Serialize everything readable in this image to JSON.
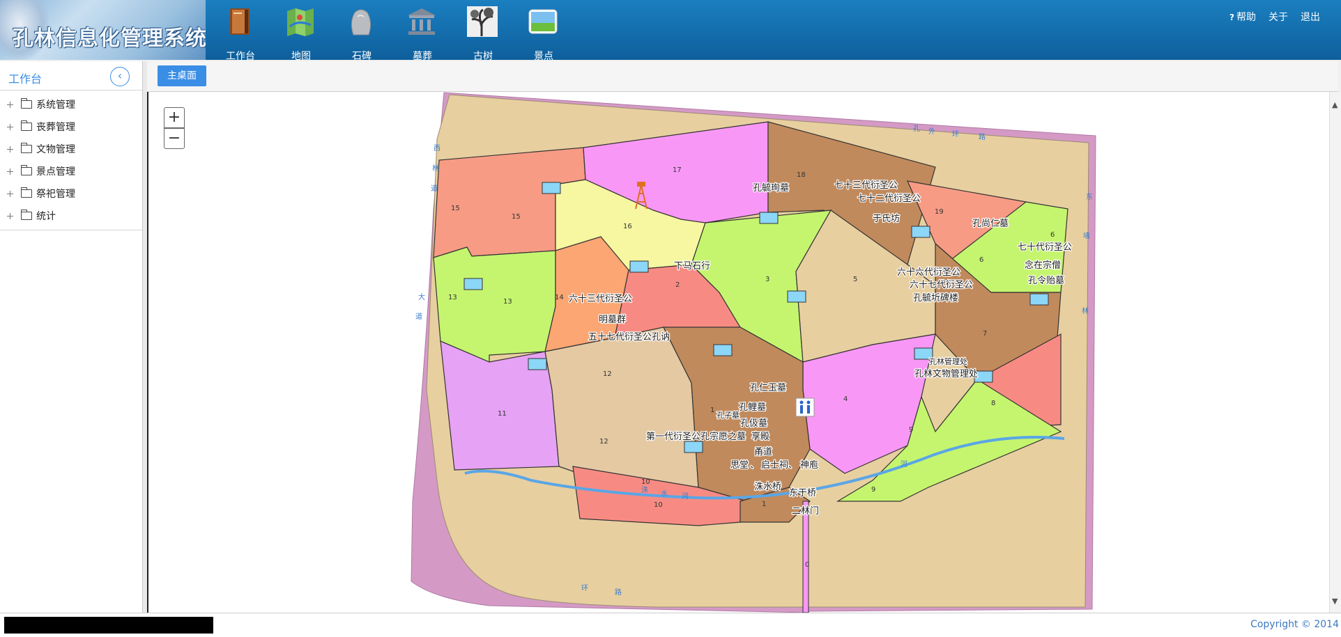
{
  "header": {
    "logo_text": "孔林信息化管理系统",
    "nav": [
      {
        "key": "workbench",
        "label": "工作台",
        "icon": "book-icon"
      },
      {
        "key": "map",
        "label": "地图",
        "icon": "map-icon"
      },
      {
        "key": "stele",
        "label": "石碑",
        "icon": "stone-icon"
      },
      {
        "key": "tomb",
        "label": "墓葬",
        "icon": "temple-icon"
      },
      {
        "key": "tree",
        "label": "古树",
        "icon": "tree-icon"
      },
      {
        "key": "scenic",
        "label": "景点",
        "icon": "landscape-icon"
      }
    ],
    "links": {
      "help": "帮助",
      "about": "关于",
      "logout": "退出"
    }
  },
  "sidebar": {
    "title": "工作台",
    "items": [
      {
        "label": "系统管理"
      },
      {
        "label": "丧葬管理"
      },
      {
        "label": "文物管理"
      },
      {
        "label": "景点管理"
      },
      {
        "label": "祭祀管理"
      },
      {
        "label": "统计"
      }
    ]
  },
  "tabs": {
    "home": "主桌面"
  },
  "map": {
    "zoom_in": "+",
    "zoom_out": "−",
    "labels": [
      "孔毓珣墓",
      "七十三代衍圣公",
      "七十二代衍圣公",
      "于氏坊",
      "孔尚仁墓",
      "七十代衍圣公",
      "念在宗僧",
      "孔令贻墓",
      "六十六代衍圣公",
      "六十七代衍圣公",
      "孔毓圻碑楼",
      "下马石行",
      "六十三代衍圣公",
      "明墓群",
      "五十七代衍圣公孔讷",
      "孔林管理处",
      "孔林文物管理处",
      "孔仁玉墓",
      "孔鲤墓",
      "孔子墓",
      "孔伋墓",
      "第一代衍圣公孔宗愿之墓",
      "享殿",
      "甬道",
      "思堂",
      "、",
      "启士祠、",
      "神庖",
      "洙水桥",
      "东于桥",
      "二林门"
    ],
    "plot_numbers": [
      "1",
      "1",
      "2",
      "3",
      "4",
      "5",
      "6",
      "6",
      "7",
      "8",
      "9",
      "9",
      "10",
      "10",
      "11",
      "12",
      "12",
      "13",
      "13",
      "14",
      "15",
      "15",
      "16",
      "17",
      "18",
      "19",
      "0"
    ],
    "road_labels": [
      "孔",
      "外",
      "环",
      "路",
      "西",
      "林",
      "道",
      "大",
      "道",
      "东",
      "墙",
      "林",
      "环",
      "路",
      "河",
      "洙",
      "水",
      "河"
    ]
  },
  "footer": {
    "copyright": "Copyright © 2014"
  },
  "colors": {
    "accent": "#3a8ee6",
    "header": "#1170b0"
  }
}
